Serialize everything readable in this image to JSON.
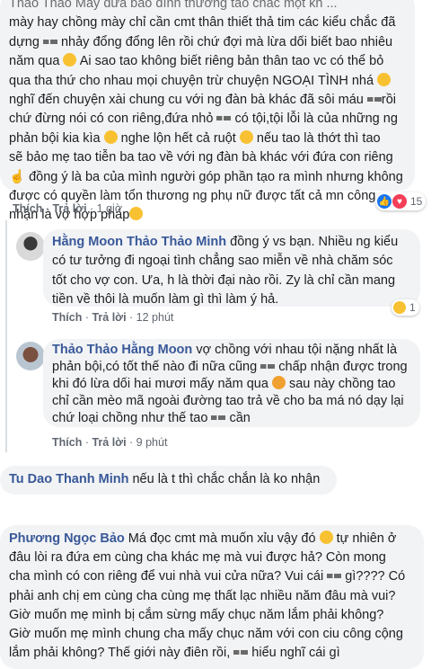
{
  "comment1": {
    "top_cut": "Thảo Thảo Mày đừa bảo đình thương tao chắc một kh ...",
    "lines": [
      "mày hay chồng mày chỉ cần cmt thân thiết thả tim các kiểu chắc đã",
      "dựng",
      "nhảy đổng đổng lên rồi chứ đợi mà lừa dối biết bao nhiêu",
      "năm qua",
      "Ai sao tao không biết riêng bản thân tao vc có thể bỏ",
      "qua tha thứ cho nhau mọi chuyện trừ chuyện NGOẠI TÌNH nhá",
      "nghĩ đến chuyện xài chung cu với ng đàn bà khác đã sôi máu",
      "rồi",
      "chứ đừng nói có con riêng,đứa nhỏ",
      "có tội,tội lỗi là của những ng",
      "phản bội kia kìa",
      "nghe lộn hết cả ruột",
      "nếu tao là thớt thì tao",
      "sẽ bảo mẹ tao tiễn ba tao về với ng đàn bà khác với đứa con riêng",
      "đồng ý là ba của mình người góp phần tạo ra mình nhưng không",
      "được có quyền làm tổn thương ng phụ nữ được tất cả mn công",
      "nhận là vợ hợp pháp"
    ],
    "actions": {
      "like": "Thích",
      "reply": "Trả lời",
      "time": "1 giờ"
    },
    "reactions": "15"
  },
  "reply1": {
    "name": "Hằng Moon",
    "mention": "Thảo Thảo Minh",
    "lines": [
      "đồng ý vs bạn. Nhiều ng kiểu",
      "có tư tưởng đi ngoại tình chẳng sao miễn về nhà chăm sóc",
      "tốt cho vợ con. Ưa, h là thời đại nào rồi. Zy là chỉ cần mang",
      "tiền về thôi là muốn làm gì thì làm ý hả."
    ],
    "actions": {
      "like": "Thích",
      "reply": "Trả lời",
      "time": "12 phút"
    },
    "reactions": "1"
  },
  "reply2": {
    "name": "Thảo Thảo",
    "mention": "Hằng Moon",
    "lines": [
      "vợ chồng với nhau tội nặng nhất là",
      "phản bội,có tốt thế nào đi nữa cũng",
      "chấp nhận được trong",
      "khi đó lừa dối hai mươi mấy năm qua",
      "sau này chồng tao",
      "chỉ cần mèo mã ngoài đường tao trả về cho ba má nó dạy lại",
      "chứ loại chồng như thế tao",
      "cần"
    ],
    "actions": {
      "like": "Thích",
      "reply": "Trả lời",
      "time": "9 phút"
    }
  },
  "comment2": {
    "name": "Tu Dao Thanh Minh",
    "text": "nếu là t thì chắc chắn là ko nhận"
  },
  "comment3": {
    "name": "Phương Ngọc Bảo",
    "lines": [
      "Má đọc cmt mà muốn xỉu vậy đó",
      "tự nhiên ở",
      "đâu lòi ra đứa em cùng cha khác mẹ mà vui được hả? Còn mong",
      "cha mình có con riêng để vui nhà vui cửa nữa? Vui cái",
      "gì???? Có",
      "phải anh chị em cùng cha cùng mẹ thất lạc nhiều năm đâu mà vui?",
      "Giờ muốn mẹ mình bị cắm sừng mấy chục năm lắm phải không?",
      "Giờ muốn mẹ mình chung cha mấy chục năm với con ciu công cộng",
      "lắm phải không? Thế giới này điên rồi,",
      "hiểu nghĩ cái gì"
    ]
  }
}
